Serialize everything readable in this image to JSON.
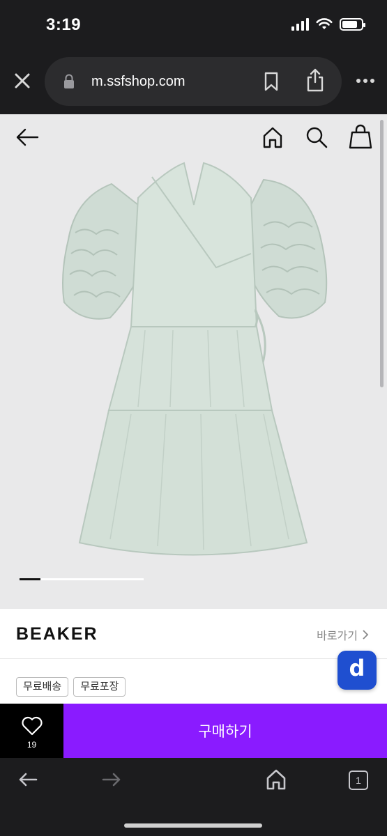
{
  "status_bar": {
    "time": "3:19",
    "icons": [
      "signal-icon",
      "wifi-icon",
      "battery-icon"
    ],
    "battery_level": 0.8
  },
  "browser": {
    "url": "m.ssfshop.com",
    "icons": [
      "close-icon",
      "lock-icon",
      "bookmark-icon",
      "share-icon",
      "more-icon"
    ]
  },
  "page_nav": {
    "icons": [
      "back-arrow-icon",
      "home-icon",
      "search-icon",
      "shopping-bag-icon"
    ]
  },
  "product": {
    "carousel_position": 1,
    "image": "mint ruffle-sleeve wrap dress"
  },
  "brand": {
    "name": "BEAKER",
    "shortcut_label": "바로가기"
  },
  "tags": [
    "무료배송",
    "무료포장"
  ],
  "floating_button": {
    "label": "d"
  },
  "actions": {
    "wishlist_count": "19",
    "buy_label": "구매하기"
  },
  "toolbar": {
    "tab_count": "1",
    "icons": [
      "back-icon",
      "forward-icon",
      "home-icon",
      "tabs-icon"
    ]
  },
  "colors": {
    "buy_button": "#8a1bff",
    "floating_button": "#1f4fd0",
    "chrome_dark": "#1c1c1e"
  }
}
